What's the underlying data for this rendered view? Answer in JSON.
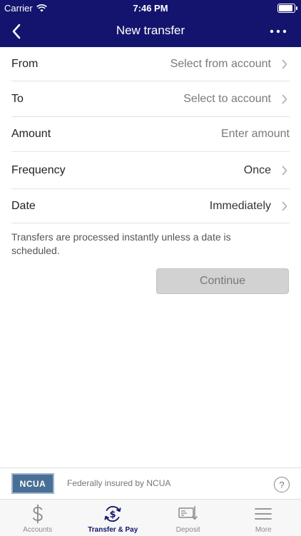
{
  "status_bar": {
    "carrier": "Carrier",
    "time": "7:46 PM",
    "battery_level": 1.0
  },
  "nav": {
    "title": "New transfer",
    "back_icon": "chevron-left-icon",
    "more_icon": "ellipsis-icon"
  },
  "form": {
    "rows": [
      {
        "label": "From",
        "value": "Select from account",
        "chevron": true
      },
      {
        "label": "To",
        "value": "Select to account",
        "chevron": true
      },
      {
        "label": "Amount",
        "placeholder": "Enter amount",
        "chevron": false
      },
      {
        "label": "Frequency",
        "value": "Once",
        "chevron": true
      },
      {
        "label": "Date",
        "value": "Immediately",
        "chevron": true
      }
    ],
    "note": "Transfers are processed instantly unless a date is scheduled.",
    "continue_label": "Continue"
  },
  "footer": {
    "ncua_logo_text": "NCUA",
    "insured_text": "Federally insured by NCUA",
    "help_label": "?"
  },
  "tabs": [
    {
      "label": "Accounts",
      "icon": "dollar-icon",
      "active": false
    },
    {
      "label": "Transfer & Pay",
      "icon": "transfer-pay-icon",
      "active": true
    },
    {
      "label": "Deposit",
      "icon": "check-deposit-icon",
      "active": false
    },
    {
      "label": "More",
      "icon": "menu-icon",
      "active": false
    }
  ],
  "colors": {
    "header_bg": "#14146e",
    "active_tab": "#14146e",
    "inactive_tab": "#8a8a8a",
    "button_bg": "#d2d2d2"
  }
}
